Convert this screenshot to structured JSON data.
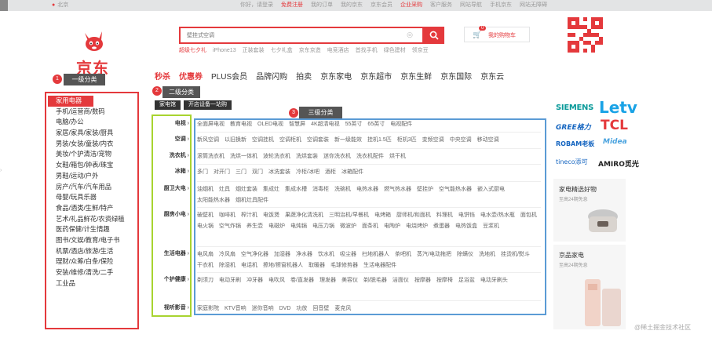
{
  "topbar": {
    "location": "北京",
    "links": [
      {
        "text": "你好，请登录",
        "red": false
      },
      {
        "text": "免费注册",
        "red": true
      },
      {
        "text": "我的订单",
        "red": false
      },
      {
        "text": "我的京东",
        "red": false
      },
      {
        "text": "京东会员",
        "red": false
      },
      {
        "text": "企业采购",
        "red": true
      },
      {
        "text": "客户服务",
        "red": false
      },
      {
        "text": "网站导航",
        "red": false
      },
      {
        "text": "手机京东",
        "red": false
      },
      {
        "text": "网站无障碍",
        "red": false
      }
    ]
  },
  "logo": {
    "text": "京东"
  },
  "search": {
    "placeholder": "壁挂式空调",
    "hotwords": [
      {
        "text": "超级七夕礼",
        "red": true
      },
      {
        "text": "iPhone13",
        "red": false
      },
      {
        "text": "正装套装",
        "red": false
      },
      {
        "text": "七夕礼盒",
        "red": false
      },
      {
        "text": "京东京造",
        "red": false
      },
      {
        "text": "电竞酒店",
        "red": false
      },
      {
        "text": "首找手机",
        "red": false
      },
      {
        "text": "绿色建材",
        "red": false
      },
      {
        "text": "领京豆",
        "red": false
      }
    ]
  },
  "cart": {
    "count": "0",
    "label": "我的购物车"
  },
  "mainnav": [
    {
      "text": "秒杀",
      "red": true
    },
    {
      "text": "优惠券",
      "red": true
    },
    {
      "text": "PLUS会员",
      "red": false
    },
    {
      "text": "品牌闪购",
      "red": false
    },
    {
      "text": "拍卖",
      "red": false
    },
    {
      "text": "京东家电",
      "red": false
    },
    {
      "text": "京东超市",
      "red": false
    },
    {
      "text": "京东生鲜",
      "red": false
    },
    {
      "text": "京东国际",
      "red": false
    },
    {
      "text": "京东云",
      "red": false
    }
  ],
  "annotations": {
    "first": {
      "num": "1",
      "label": "一级分类"
    },
    "second": {
      "num": "2",
      "label": "二级分类"
    },
    "third": {
      "num": "3",
      "label": "三级分类"
    }
  },
  "categories": [
    "家用电器",
    "手机/运营商/数码",
    "电脑/办公",
    "家居/家具/家装/厨具",
    "男装/女装/童装/内衣",
    "美妆/个护清洁/宠物",
    "女鞋/箱包/钟表/珠宝",
    "男鞋/运动/户外",
    "房产/汽车/汽车用品",
    "母婴/玩具乐器",
    "食品/酒类/生鲜/特产",
    "艺术/礼品鲜花/农资绿植",
    "医药保健/计生情趣",
    "图书/文娱/教育/电子书",
    "机票/酒店/旅游/生活",
    "理财/众筹/白条/保险",
    "安装/维修/清洗/二手",
    "工业品"
  ],
  "tags": [
    "家电馆",
    "开店设备一站购"
  ],
  "subcategories": [
    {
      "name": "电视",
      "items": [
        "全面屏电视",
        "教育电视",
        "OLED电视",
        "智慧屏",
        "4K超清电视",
        "55英寸",
        "65英寸",
        "电视配件"
      ]
    },
    {
      "name": "空调",
      "items": [
        "新风空调",
        "以旧换新",
        "空调挂机",
        "空调柜机",
        "空调套装",
        "新一级能效",
        "挂机1.5匹",
        "柜机3匹",
        "变频空调",
        "中央空调",
        "移动空调"
      ]
    },
    {
      "name": "洗衣机",
      "items": [
        "滚筒洗衣机",
        "洗烘一体机",
        "波轮洗衣机",
        "洗烘套装",
        "迷你洗衣机",
        "洗衣机配件",
        "烘干机"
      ]
    },
    {
      "name": "冰箱",
      "items": [
        "多门",
        "对开门",
        "三门",
        "双门",
        "冰洗套装",
        "冷柜/冰吧",
        "酒柜",
        "冰箱配件"
      ]
    },
    {
      "name": "厨卫大电",
      "items": [
        "油烟机",
        "灶具",
        "烟灶套装",
        "集成灶",
        "集成水槽",
        "消毒柜",
        "洗碗机",
        "电热水器",
        "燃气热水器",
        "壁挂炉",
        "空气能热水器",
        "嵌入式厨电",
        "太阳能热水器",
        "烟机灶具配件"
      ]
    },
    {
      "name": "厨房小电",
      "items": [
        "破壁机",
        "咖啡机",
        "榨汁机",
        "电饭煲",
        "果蔬净化清洗机",
        "三明治机/早餐机",
        "电烤箱",
        "厨师机/和面机",
        "料理机",
        "电饼铛",
        "电水壶/热水瓶",
        "面包机",
        "电火锅",
        "空气炸锅",
        "养生壶",
        "电磁炉",
        "电炖锅",
        "电压力锅",
        "微波炉",
        "面条机",
        "电陶炉",
        "电烧烤炉",
        "煮蛋器",
        "电热饭盒",
        "豆浆机"
      ]
    },
    {
      "name": "生活电器",
      "items": [
        "电风扇",
        "冷风扇",
        "空气净化器",
        "加湿器",
        "净水器",
        "饮水机",
        "吸尘器",
        "扫地机器人",
        "茶吧机",
        "蒸汽/电动拖把",
        "除螨仪",
        "洗地机",
        "挂烫机/熨斗",
        "干衣机",
        "除湿机",
        "电话机",
        "擦地/擦窗机器人",
        "取暖器",
        "毛球修剪器",
        "生活电器配件"
      ]
    },
    {
      "name": "个护健康",
      "items": [
        "剃须刀",
        "电动牙刷",
        "冲牙器",
        "电吹风",
        "卷/直发器",
        "理发器",
        "美容仪",
        "剃/脱毛器",
        "洁面仪",
        "按摩器",
        "按摩椅",
        "足浴盆",
        "电动牙刷头"
      ]
    },
    {
      "name": "视听影音",
      "items": [
        "家庭影院",
        "KTV音响",
        "迷你音响",
        "DVD",
        "功放",
        "回音壁",
        "麦克风"
      ]
    }
  ],
  "brands": [
    "SIEMENS",
    "Letv",
    "GREE格力",
    "TCL",
    "ROBAM老板",
    "Midea",
    "tineco添可",
    "AMIRO觅光"
  ],
  "promos": [
    {
      "title": "家电精选好物",
      "subtitle": "至高24期免息"
    },
    {
      "title": "京品家电",
      "subtitle": "至高24期免息"
    }
  ],
  "watermark": "@稀土掘金技术社区"
}
